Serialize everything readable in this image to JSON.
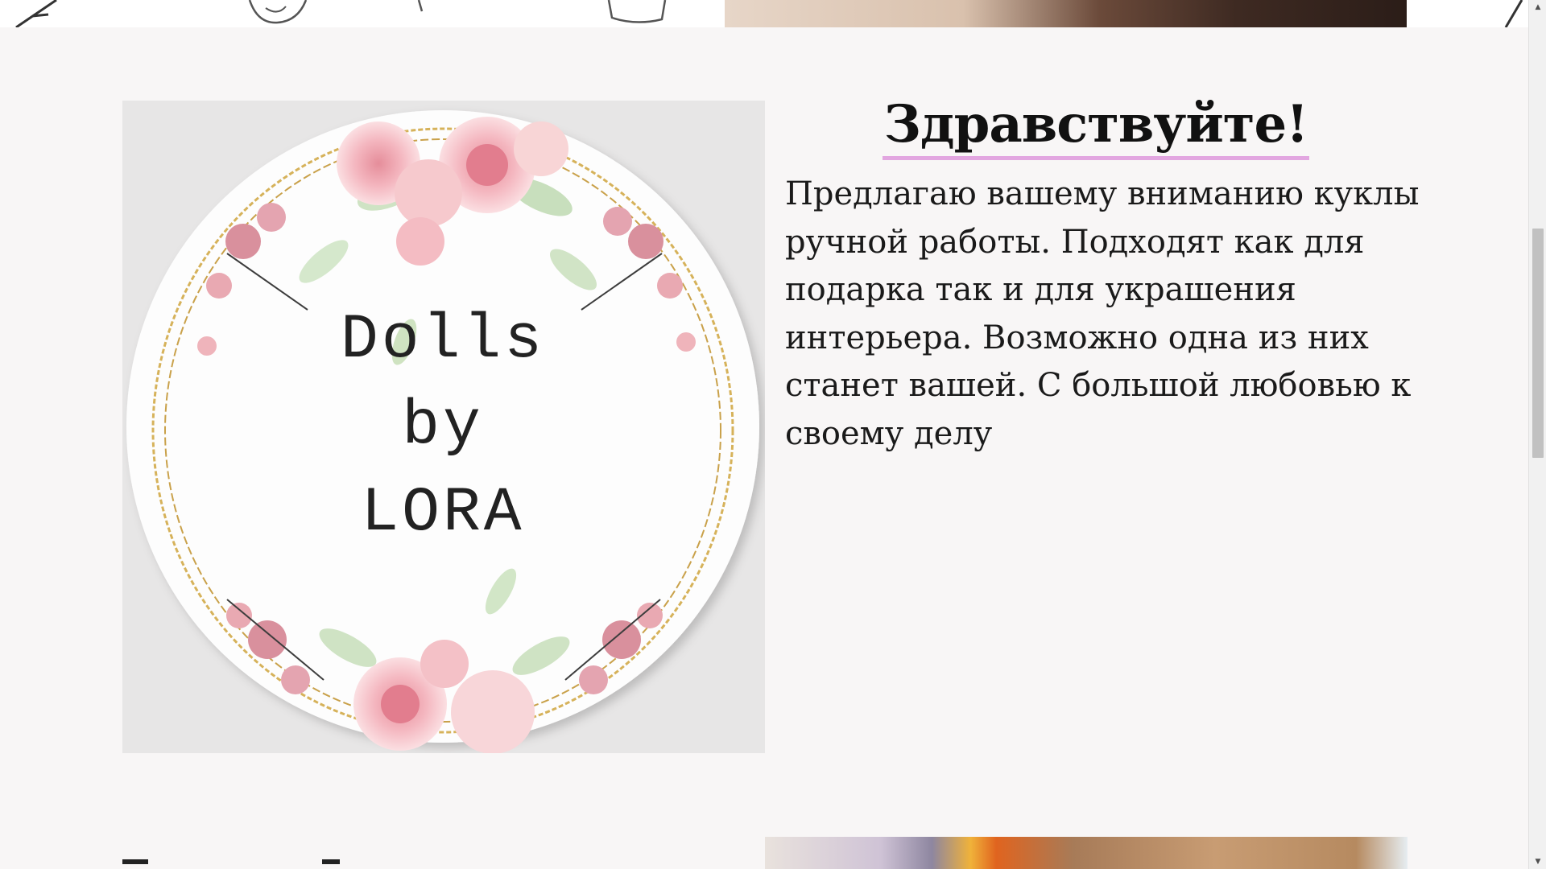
{
  "logo": {
    "line1": "Dolls",
    "line2": "by",
    "line3": "LORA"
  },
  "greeting": {
    "title": "Здравствуйте!",
    "body": "Предлагаю вашему вниманию куклы ручной работы. Подходят как для подарка так и для украшения интерьера. Возможно одна из них станет вашей. С большой любовью к своему делу"
  },
  "colors": {
    "page_background": "#f8f6f6",
    "title_underline": "#e2a6e0",
    "text": "#1a1a1a"
  },
  "icons": {
    "scroll_up": "▲",
    "scroll_down": "▼"
  }
}
